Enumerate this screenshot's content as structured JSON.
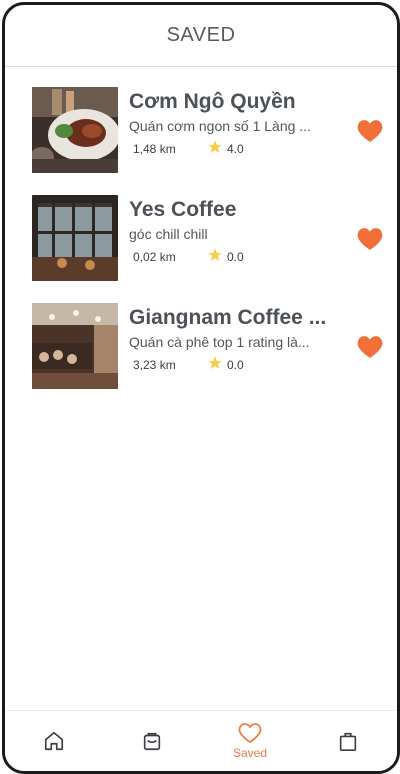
{
  "header": {
    "title": "SAVED"
  },
  "colors": {
    "accent": "#ef7e45",
    "heart": "#f26f3a",
    "star": "#f5cf4b",
    "text": "#4d5258"
  },
  "saved_items": [
    {
      "title": "Cơm Ngô Quyền",
      "description": "Quán cơm ngon số 1 Làng ...",
      "distance": "1,48 km",
      "rating": "4.0",
      "favorite_icon": "heart-filled-icon"
    },
    {
      "title": "Yes Coffee",
      "description": "góc chill chill",
      "distance": "0,02 km",
      "rating": "0.0",
      "favorite_icon": "heart-filled-icon"
    },
    {
      "title": "Giangnam Coffee ...",
      "description": "Quán cà phê top 1 rating là...",
      "distance": "3,23 km",
      "rating": "0.0",
      "favorite_icon": "heart-filled-icon"
    }
  ],
  "tabbar": {
    "tabs": [
      {
        "icon": "home-icon",
        "label": ""
      },
      {
        "icon": "basket-icon",
        "label": ""
      },
      {
        "icon": "heart-outline-icon",
        "label": "Saved",
        "active": true
      },
      {
        "icon": "shopping-bag-icon",
        "label": ""
      }
    ]
  }
}
